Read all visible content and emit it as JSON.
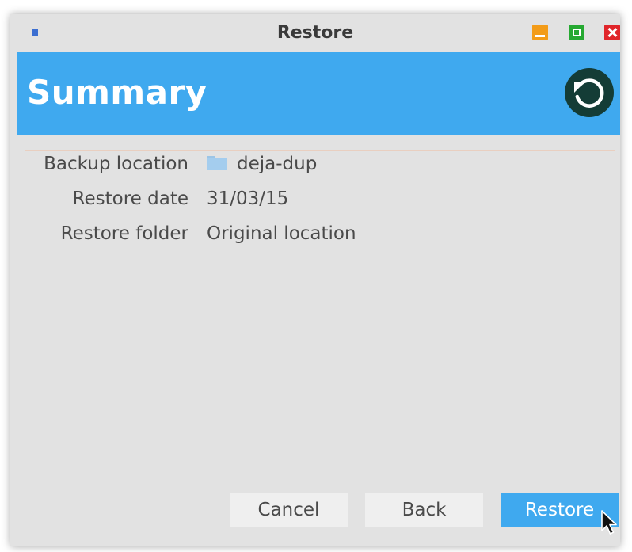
{
  "window": {
    "title": "Restore"
  },
  "header": {
    "title": "Summary",
    "logo_icon": "restore-icon"
  },
  "summary": {
    "rows": [
      {
        "label": "Backup location",
        "value": "deja-dup",
        "icon": "folder-icon"
      },
      {
        "label": "Restore date",
        "value": "31/03/15"
      },
      {
        "label": "Restore folder",
        "value": "Original location"
      }
    ]
  },
  "buttons": {
    "cancel": "Cancel",
    "back": "Back",
    "restore": "Restore"
  },
  "colors": {
    "accent": "#3fa9ef",
    "window_bg": "#e2e2e2",
    "logo_bg": "#143c36",
    "minimize": "#f39c19",
    "maximize": "#26a932",
    "close": "#e0252a"
  }
}
